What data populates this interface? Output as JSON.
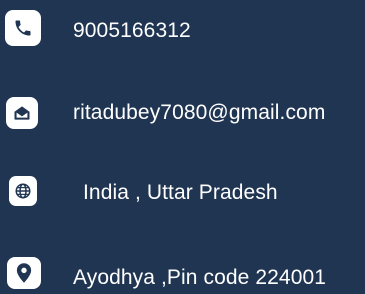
{
  "colors": {
    "background": "#1f3552",
    "icon_background": "#ffffff",
    "icon_glyph": "#1f3552",
    "text": "#ffffff"
  },
  "contact": {
    "phone": {
      "icon": "phone-icon",
      "text": "9005166312"
    },
    "email": {
      "icon": "envelope-icon",
      "text": "ritadubey7080@gmail.com"
    },
    "location": {
      "icon": "globe-icon",
      "text": "India , Uttar Pradesh"
    },
    "address": {
      "icon": "map-pin-icon",
      "text": "Ayodhya ,Pin code 224001"
    }
  }
}
